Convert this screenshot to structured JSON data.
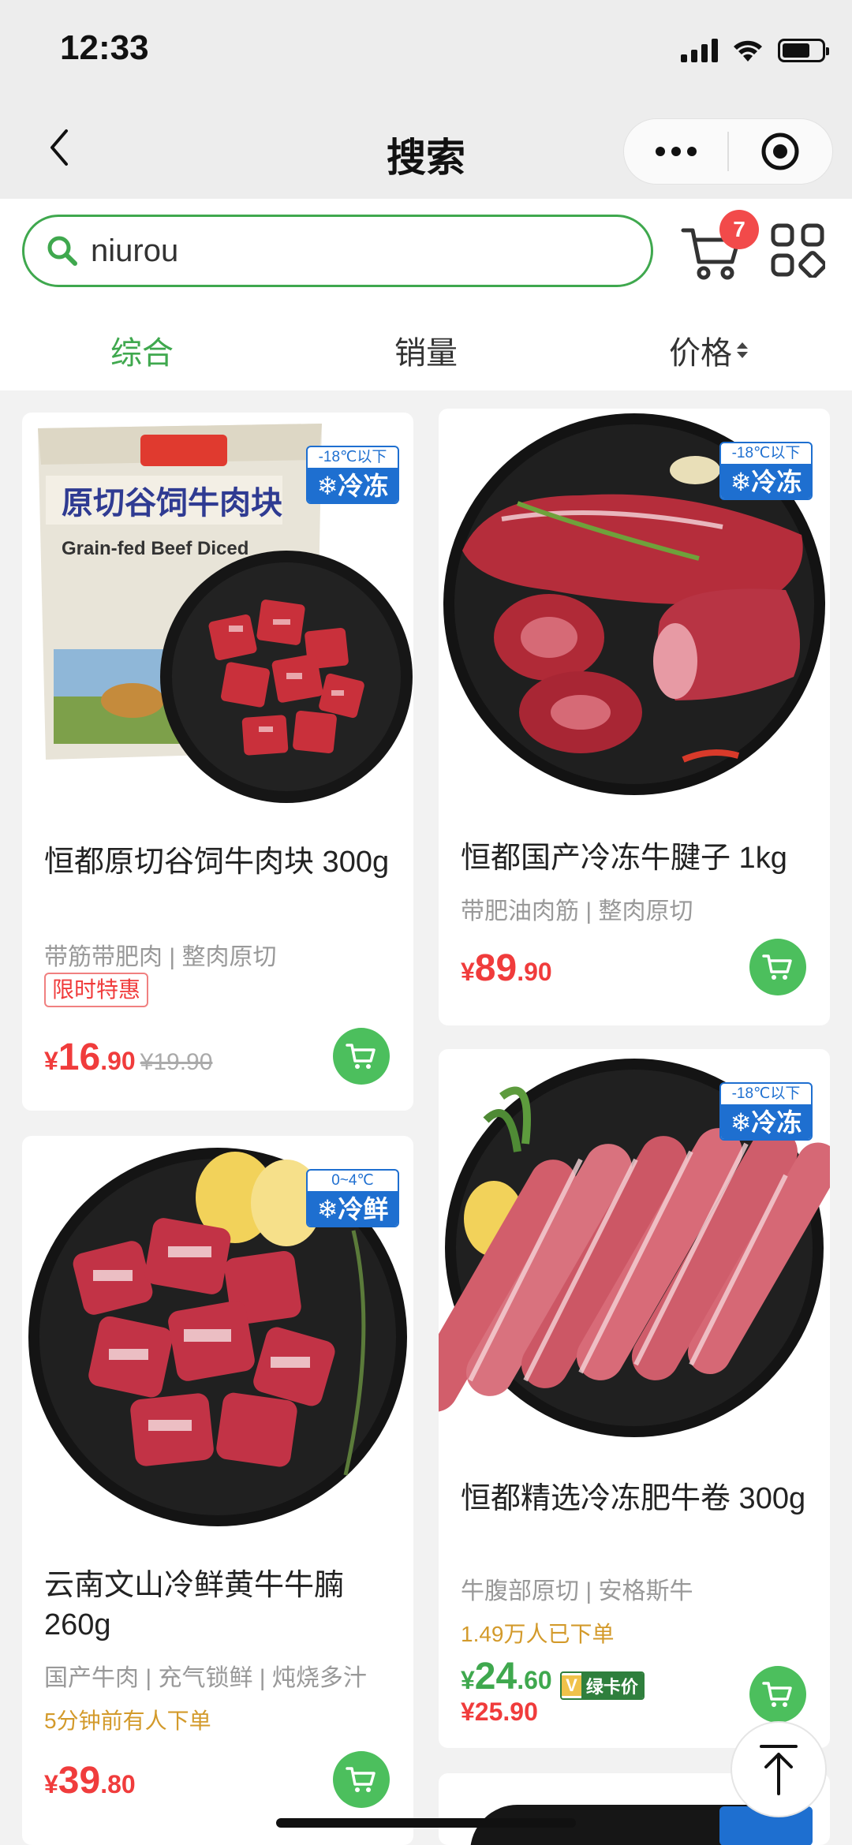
{
  "status_bar": {
    "time": "12:33"
  },
  "title_bar": {
    "title": "搜索"
  },
  "search": {
    "query": "niurou",
    "cart_count": "7"
  },
  "sort_tabs": {
    "comprehensive": "综合",
    "sales": "销量",
    "price": "价格"
  },
  "products": [
    {
      "title": "恒都原切谷饲牛肉块 300g",
      "tags": "带筋带肥肉 | 整肉原切",
      "promo": "限时特惠",
      "badge_range": "-18℃以下",
      "badge_kind": "❄冷冻",
      "price_currency": "¥",
      "price_int": "16",
      "price_dec": ".90",
      "price_original": "¥19.90"
    },
    {
      "title": "恒都国产冷冻牛腱子 1kg",
      "tags": "带肥油肉筋 | 整肉原切",
      "badge_range": "-18℃以下",
      "badge_kind": "❄冷冻",
      "price_currency": "¥",
      "price_int": "89",
      "price_dec": ".90"
    },
    {
      "title": "云南文山冷鲜黄牛牛腩 260g",
      "tags": "国产牛肉 | 充气锁鲜 | 炖烧多汁",
      "note": "5分钟前有人下单",
      "badge_range": "0~4℃",
      "badge_kind": "❄冷鲜",
      "price_currency": "¥",
      "price_int": "39",
      "price_dec": ".80"
    },
    {
      "title": "恒都精选冷冻肥牛卷 300g",
      "tags": "牛腹部原切 | 安格斯牛",
      "note": "1.49万人已下单",
      "badge_range": "-18℃以下",
      "badge_kind": "❄冷冻",
      "price_currency": "¥",
      "price_int": "24",
      "price_dec": ".60",
      "member_label": "绿卡价",
      "member_v": "V",
      "price_secondary": "¥25.90"
    }
  ],
  "colors": {
    "accent": "#3fa84e",
    "price": "#f03c3c",
    "badge_blue": "#1e6fd0"
  }
}
